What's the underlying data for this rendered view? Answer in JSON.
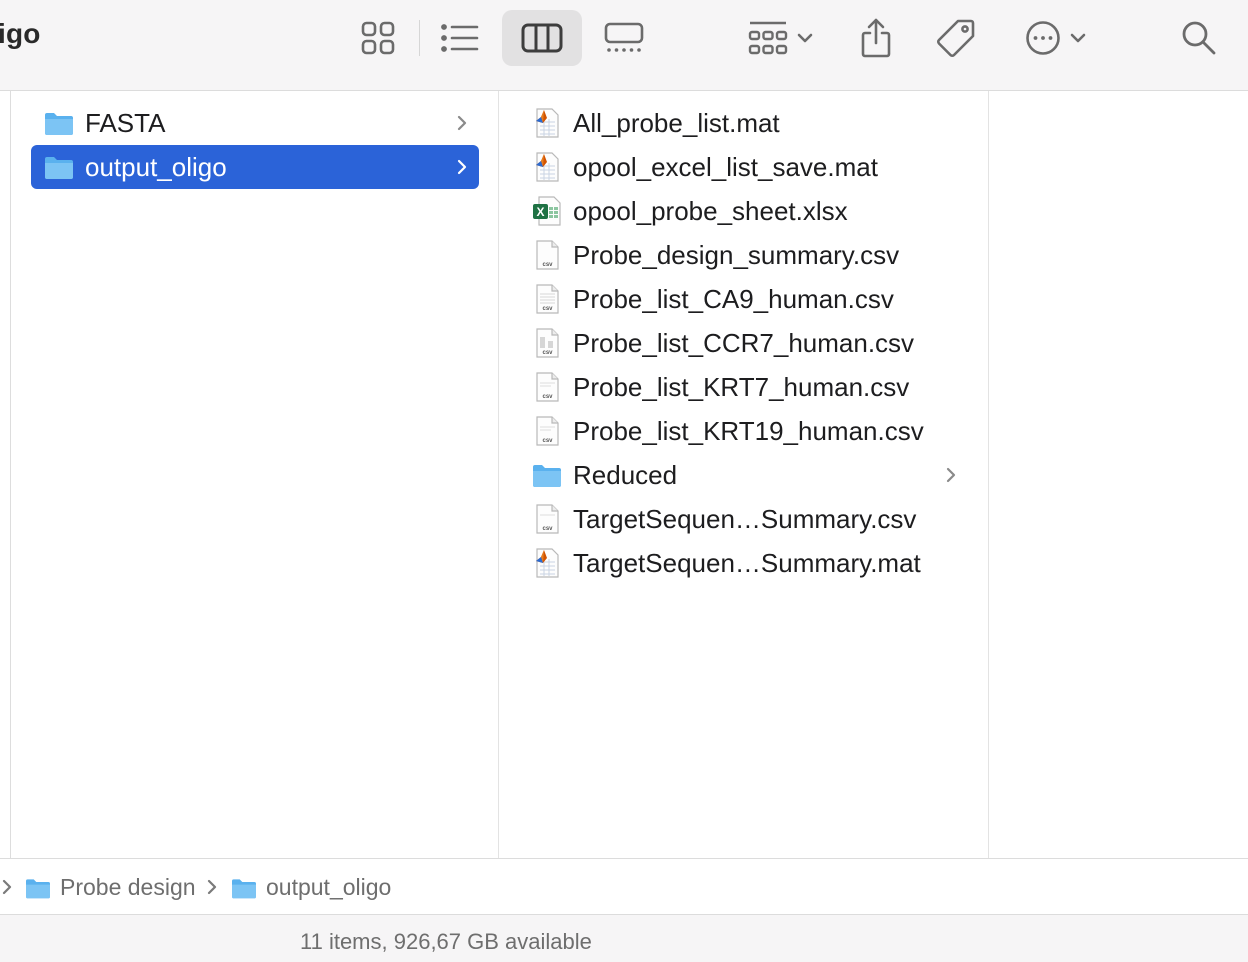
{
  "window": {
    "title": "igo"
  },
  "toolbar": {
    "views": [
      {
        "name": "icon-view",
        "active": false
      },
      {
        "name": "list-view",
        "active": false
      },
      {
        "name": "column-view",
        "active": true
      },
      {
        "name": "gallery-view",
        "active": false
      }
    ],
    "group_icon": "group-grid-icon",
    "share_icon": "share-icon",
    "tag_icon": "tag-icon",
    "more_icon": "ellipsis-circle-icon",
    "search_icon": "search-icon"
  },
  "columns": {
    "first": [
      {
        "name": "FASTA",
        "kind": "folder",
        "selected": false,
        "has_children": true
      },
      {
        "name": "output_oligo",
        "kind": "folder",
        "selected": true,
        "has_children": true
      }
    ],
    "second": [
      {
        "name": "All_probe_list.mat",
        "kind": "mat"
      },
      {
        "name": "opool_excel_list_save.mat",
        "kind": "mat"
      },
      {
        "name": "opool_probe_sheet.xlsx",
        "kind": "xlsx"
      },
      {
        "name": "Probe_design_summary.csv",
        "kind": "csv"
      },
      {
        "name": "Probe_list_CA9_human.csv",
        "kind": "csv"
      },
      {
        "name": "Probe_list_CCR7_human.csv",
        "kind": "csv"
      },
      {
        "name": "Probe_list_KRT7_human.csv",
        "kind": "csv"
      },
      {
        "name": "Probe_list_KRT19_human.csv",
        "kind": "csv"
      },
      {
        "name": "Reduced",
        "kind": "folder",
        "has_children": true
      },
      {
        "name": "TargetSequen…Summary.csv",
        "kind": "csv"
      },
      {
        "name": "TargetSequen…Summary.mat",
        "kind": "mat"
      }
    ],
    "csv_badge": "csv"
  },
  "pathbar": {
    "items": [
      {
        "label": "Probe design"
      },
      {
        "label": "output_oligo"
      }
    ]
  },
  "status": {
    "text": "11 items, 926,67 GB available"
  },
  "colors": {
    "selection": "#2b63d8",
    "folder": "#5ab1ee",
    "excel_green": "#1f7244",
    "toolbar_bg": "#f6f5f6"
  }
}
